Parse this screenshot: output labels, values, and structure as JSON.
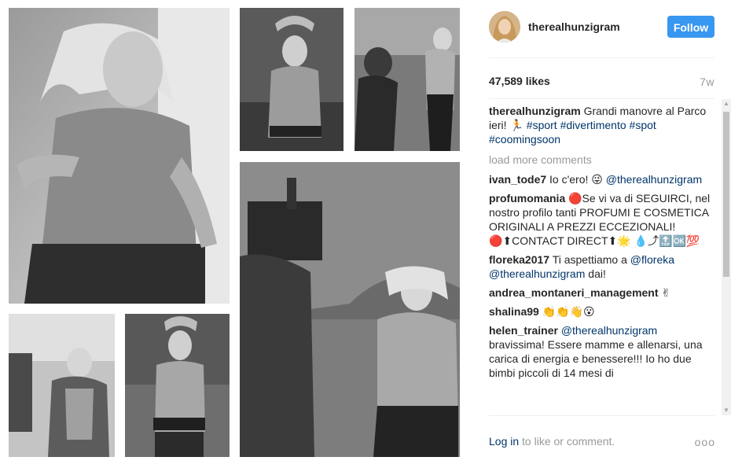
{
  "post": {
    "username": "therealhunzigram",
    "follow_label": "Follow",
    "likes": "47,589 likes",
    "age": "7w"
  },
  "caption": {
    "user": "therealhunzigram",
    "text": "Grandi manovre al Parco ieri! 🏃",
    "tags": [
      "#sport",
      "#divertimento",
      "#spot",
      "#coomingsoon"
    ]
  },
  "load_more": "load more comments",
  "comments": [
    {
      "user": "ivan_tode7",
      "text": "Io c'ero! 😜",
      "mention": "@therealhunzigram",
      "after": ""
    },
    {
      "user": "profumomania",
      "text": "🔴Se vi va di SEGUIRCI, nel nostro profilo tanti PROFUMI E COSMETICA ORIGINALI A PREZZI ECCEZIONALI!🔴⬆CONTACT DIRECT⬆🌟 💧⤴🔝🆗💯",
      "mention": "",
      "after": ""
    },
    {
      "user": "floreka2017",
      "text": "Ti aspettiamo a",
      "mention": "@floreka @therealhunzigram",
      "after": "dai!"
    },
    {
      "user": "andrea_montaneri_management",
      "text": "✌",
      "mention": "",
      "after": ""
    },
    {
      "user": "shalina99",
      "text": "👏👏👋😮",
      "mention": "",
      "after": ""
    },
    {
      "user": "helen_trainer",
      "text": "",
      "mention": "@therealhunzigram",
      "after": "bravissima! Essere mamme e allenarsi, una carica di energia e benessere!!! Io ho due bimbi piccoli di 14 mesi di"
    }
  ],
  "footer": {
    "login": "Log in",
    "rest": "to like or comment.",
    "more": "ooo"
  },
  "icons": {
    "more_options": "more-options-icon",
    "scroll_up": "scroll-up-arrow-icon",
    "scroll_down": "scroll-down-arrow-icon"
  },
  "colors": {
    "follow_button": "#3897f0",
    "link": "#003569",
    "muted": "#999999"
  }
}
